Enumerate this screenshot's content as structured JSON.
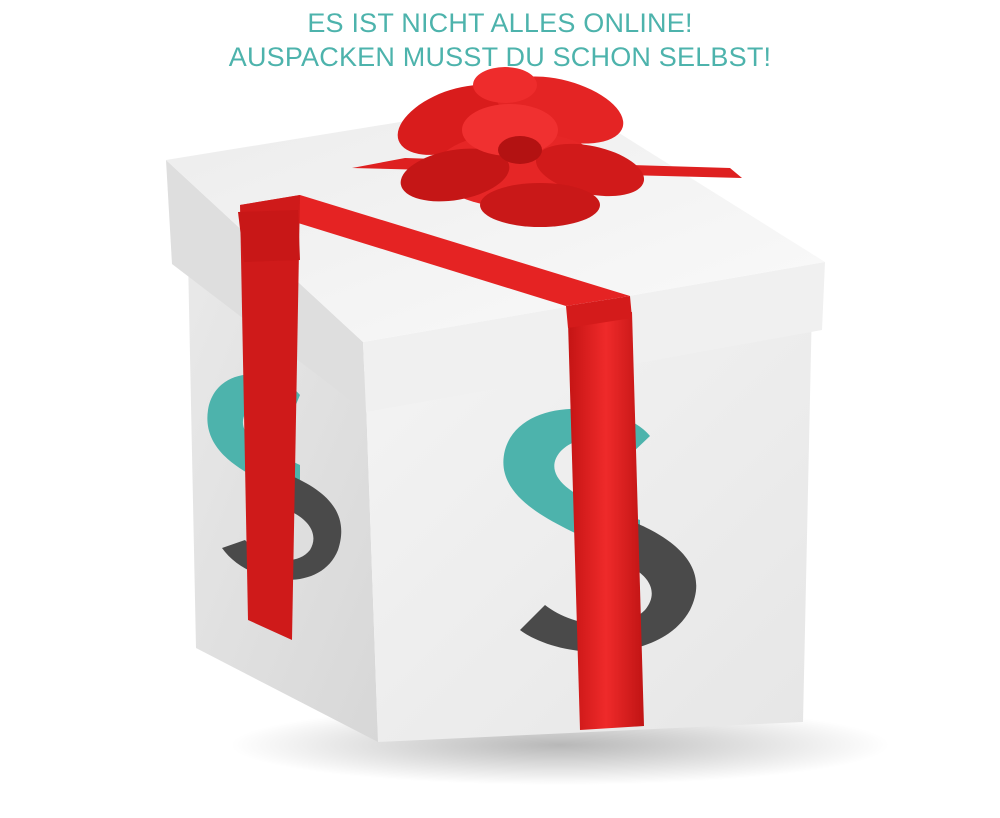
{
  "headline": {
    "line1": "ES IST NICHT ALLES ONLINE!",
    "line2": "AUSPACKEN MUSST DU SCHON SELBST!"
  },
  "colors": {
    "headline": "#4db3ac",
    "ribbon": "#e01f1f",
    "logo_teal": "#4db3ac",
    "logo_dark": "#4a4a4a",
    "box": "#f2f2f2"
  },
  "image": {
    "subject-icon": "gift-box-with-red-ribbon-and-s-logo-icon"
  }
}
